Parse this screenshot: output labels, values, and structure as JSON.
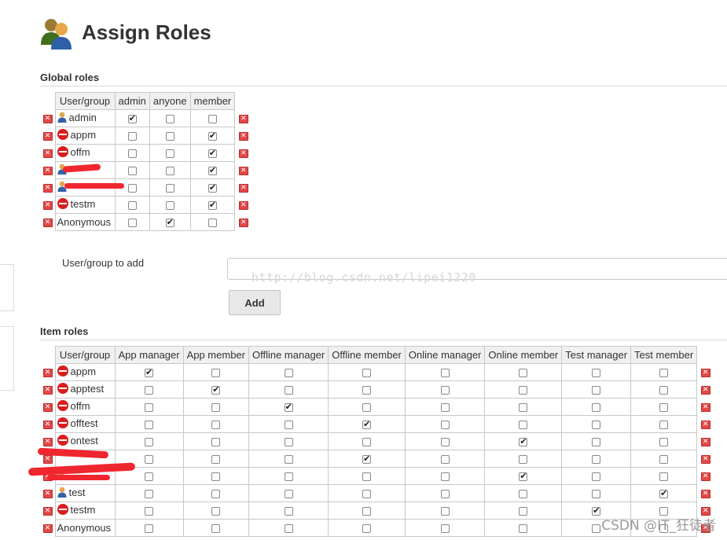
{
  "page": {
    "title": "Assign Roles"
  },
  "global": {
    "title": "Global roles",
    "header_user": "User/group",
    "roles": [
      "admin",
      "anyone",
      "member"
    ],
    "rows": [
      {
        "name": "admin",
        "icon": "user-icon",
        "checks": [
          true,
          false,
          false
        ]
      },
      {
        "name": "appm",
        "icon": "no-entry-icon",
        "checks": [
          false,
          false,
          true
        ]
      },
      {
        "name": "offm",
        "icon": "no-entry-icon",
        "checks": [
          false,
          false,
          true
        ]
      },
      {
        "name": "",
        "icon": "user-icon",
        "checks": [
          false,
          false,
          true
        ]
      },
      {
        "name": "",
        "icon": "user-icon",
        "checks": [
          false,
          false,
          true
        ]
      },
      {
        "name": "testm",
        "icon": "no-entry-icon",
        "checks": [
          false,
          false,
          true
        ]
      },
      {
        "name": "Anonymous",
        "icon": "",
        "checks": [
          false,
          true,
          false
        ]
      }
    ]
  },
  "add": {
    "label": "User/group to add",
    "value": "",
    "button": "Add",
    "watermark": "http://blog.csdn.net/lipei1220"
  },
  "item": {
    "title": "Item roles",
    "header_user": "User/group",
    "roles": [
      "App manager",
      "App member",
      "Offline manager",
      "Offline member",
      "Online manager",
      "Online member",
      "Test manager",
      "Test member"
    ],
    "rows": [
      {
        "name": "appm",
        "icon": "no-entry-icon",
        "checks": [
          true,
          false,
          false,
          false,
          false,
          false,
          false,
          false
        ]
      },
      {
        "name": "apptest",
        "icon": "no-entry-icon",
        "checks": [
          false,
          true,
          false,
          false,
          false,
          false,
          false,
          false
        ]
      },
      {
        "name": "offm",
        "icon": "no-entry-icon",
        "checks": [
          false,
          false,
          true,
          false,
          false,
          false,
          false,
          false
        ]
      },
      {
        "name": "offtest",
        "icon": "no-entry-icon",
        "checks": [
          false,
          false,
          false,
          true,
          false,
          false,
          false,
          false
        ]
      },
      {
        "name": "ontest",
        "icon": "no-entry-icon",
        "checks": [
          false,
          false,
          false,
          false,
          false,
          true,
          false,
          false
        ]
      },
      {
        "name": "",
        "icon": "",
        "checks": [
          false,
          false,
          false,
          true,
          false,
          false,
          false,
          false
        ]
      },
      {
        "name": "",
        "icon": "user-icon",
        "checks": [
          false,
          false,
          false,
          false,
          false,
          true,
          false,
          false
        ]
      },
      {
        "name": "test",
        "icon": "user-icon",
        "checks": [
          false,
          false,
          false,
          false,
          false,
          false,
          false,
          true
        ]
      },
      {
        "name": "testm",
        "icon": "no-entry-icon",
        "checks": [
          false,
          false,
          false,
          false,
          false,
          false,
          true,
          false
        ]
      },
      {
        "name": "Anonymous",
        "icon": "",
        "checks": [
          false,
          false,
          false,
          false,
          false,
          false,
          false,
          false
        ]
      }
    ]
  },
  "footer_watermark": "CSDN @IT_狂徒者",
  "colors": {
    "delete_red": "#e24848",
    "no_entry_red": "#d81e1e",
    "header_bg": "#f0f0f0"
  }
}
